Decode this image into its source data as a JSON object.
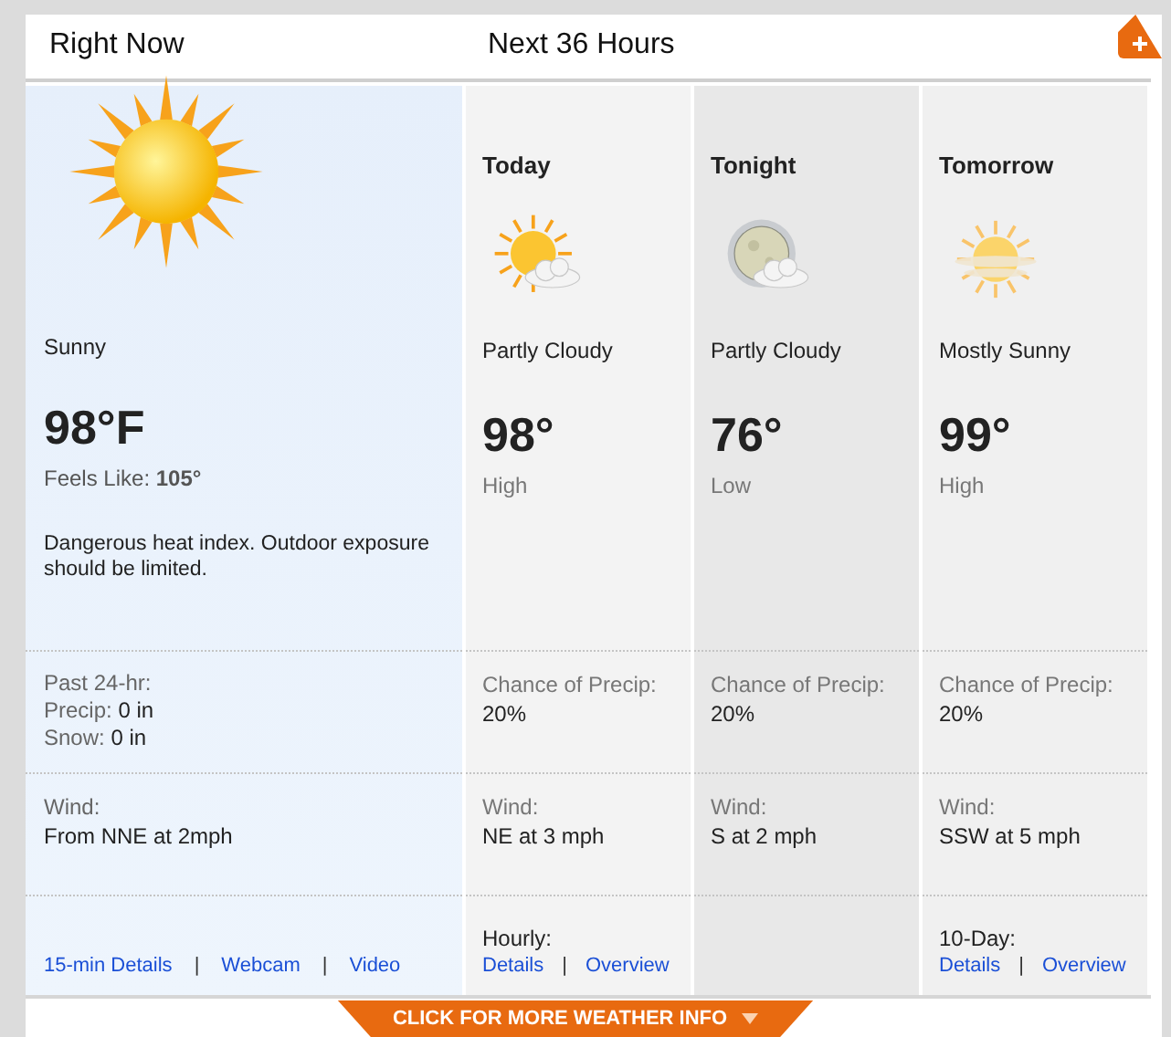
{
  "headings": [
    "Right Now",
    "Next 36 Hours"
  ],
  "current": {
    "condition": "Sunny",
    "temp": "98°F",
    "feels_like": "Feels Like: **105°**",
    "alert": "Dangerous heat index. Outdoor exposure should be limited.",
    "past_label": "Past 24-hr:",
    "precip_label": "Precip:",
    "precip_value": "0 in",
    "snow_label": "Snow:",
    "snow_value": "0 in",
    "wind_label": "Wind:",
    "wind_value": "From NNE at 2mph",
    "links": [
      "15-min Details",
      "Webcam",
      "Video"
    ],
    "separator": "|"
  },
  "periods": [
    {
      "name": "Today",
      "kind": "partly-cloudy-day",
      "condition": "Partly Cloudy",
      "temp": "98°",
      "temp_label": "High",
      "precip_label": "Chance of Precip:",
      "precip_value": "20%",
      "wind_label": "Wind:",
      "wind_value": "NE at 3 mph",
      "links_label": "Hourly:",
      "links": [
        "Details",
        "Overview"
      ]
    },
    {
      "name": "Tonight",
      "kind": "partly-cloudy-night",
      "condition": "Partly Cloudy",
      "temp": "76°",
      "temp_label": "Low",
      "precip_label": "Chance of Precip:",
      "precip_value": "20%",
      "wind_label": "Wind:",
      "wind_value": "S at 2 mph"
    },
    {
      "name": "Tomorrow",
      "kind": "mostly-sunny",
      "condition": "Mostly Sunny",
      "temp": "99°",
      "temp_label": "High",
      "precip_label": "Chance of Precip:",
      "precip_value": "20%",
      "wind_label": "Wind:",
      "wind_value": "SSW at 5 mph",
      "links_label": "10-Day:",
      "links": [
        "Details",
        "Overview"
      ]
    }
  ],
  "more_button": "CLICK FOR MORE WEATHER INFO"
}
